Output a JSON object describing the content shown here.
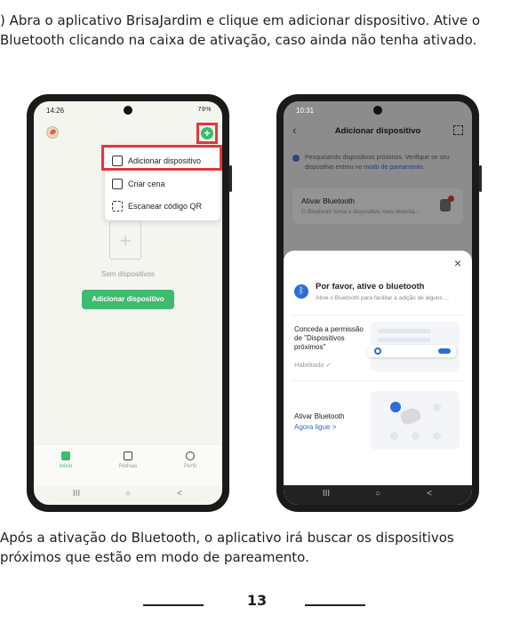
{
  "caption_top": ") Abra o aplicativo BrisaJardim e clique em adicionar dispositivo. Ative o Bluetooth clicando na caixa de ativação, caso ainda não tenha ativado.",
  "caption_bottom": "Após a ativação do Bluetooth, o aplicativo irá buscar os dispositivos próximos que estão em modo de pareamento.",
  "page_number": "13",
  "colors": {
    "accent_green": "#3dbb6e",
    "highlight_red": "#e5383b",
    "bluetooth_blue": "#2b6ed8"
  },
  "phone1": {
    "status_time": "14:26",
    "status_right": "79%",
    "add_icon": "+",
    "menu": [
      "Adicionar dispositivo",
      "Criar cena",
      "Escanear código QR"
    ],
    "empty_text": "Sem dispositivos",
    "add_button": "Adicionar dispositivo",
    "tabs": [
      "Início",
      "Rotinas",
      "Perfil"
    ],
    "nav": [
      "III",
      "○",
      "<"
    ]
  },
  "phone2": {
    "status_time": "10:31",
    "title": "Adicionar dispositivo",
    "scan_notice": "Pesquisando dispositivos próximos. Verifique se seu dispositivo entrou no",
    "scan_notice_link": "modo de pareamento.",
    "bt_card_title": "Ativar Bluetooth",
    "bt_card_sub": "O Bluetooth torna o dispositivo mais detectá...",
    "sheet_close": "×",
    "sheet_title": "Por favor, ative o bluetooth",
    "sheet_sub": "Ative o Bluetooth para facilitar a adição de alguns ...",
    "step1_label": "Conceda a permissão de \"Dispositivos próximos\"",
    "step1_status": "Habilitado ✓",
    "step2_label": "Ativar Bluetooth",
    "step2_link": "Agora ligue >",
    "nav": [
      "III",
      "○",
      "<"
    ]
  }
}
